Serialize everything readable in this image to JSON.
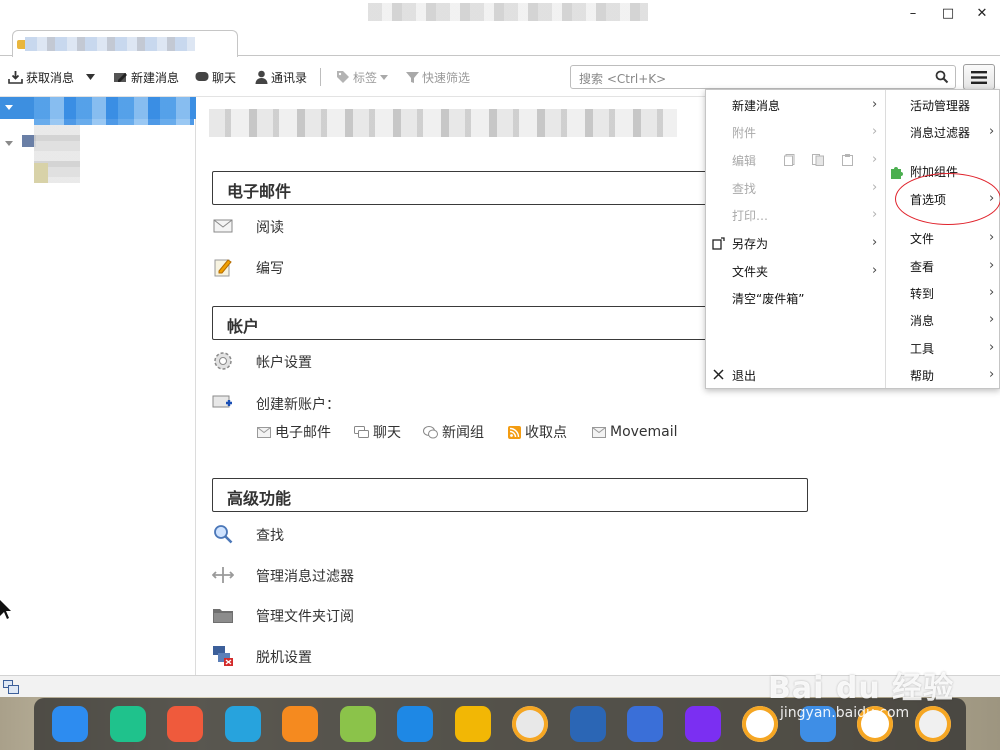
{
  "window": {
    "minimize_glyph": "–",
    "maximize_glyph": "□",
    "close_glyph": "✕"
  },
  "toolbar": {
    "get_messages": "获取消息",
    "new_message": "新建消息",
    "chat": "聊天",
    "address_book": "通讯录",
    "tag": "标签",
    "quick_filter": "快速筛选",
    "search_placeholder": "搜索 <Ctrl+K>"
  },
  "main": {
    "sections": [
      {
        "title": "电子邮件",
        "items": [
          {
            "label": "阅读",
            "icon": "read-mail-icon"
          },
          {
            "label": "编写",
            "icon": "compose-icon"
          }
        ]
      },
      {
        "title": "帐户",
        "items": [
          {
            "label": "帐户设置",
            "icon": "gear-icon"
          },
          {
            "label": "创建新账户：",
            "icon": "new-account-icon"
          }
        ]
      },
      {
        "title": "高级功能",
        "items": [
          {
            "label": "查找",
            "icon": "search-icon"
          },
          {
            "label": "管理消息过滤器",
            "icon": "filter-icon"
          },
          {
            "label": "管理文件夹订阅",
            "icon": "folder-icon"
          },
          {
            "label": "脱机设置",
            "icon": "offline-icon"
          }
        ]
      }
    ],
    "new_account_types": [
      "电子邮件",
      "聊天",
      "新闻组",
      "收取点",
      "Movemail"
    ]
  },
  "menu": {
    "left": [
      {
        "label": "新建消息",
        "enabled": true,
        "submenu": true
      },
      {
        "label": "附件",
        "enabled": false,
        "submenu": true
      },
      {
        "label": "编辑",
        "enabled": false,
        "submenu": true
      },
      {
        "label": "查找",
        "enabled": false,
        "submenu": true
      },
      {
        "label": "打印…",
        "enabled": false,
        "submenu": true
      },
      {
        "label": "另存为",
        "enabled": true,
        "submenu": true
      },
      {
        "label": "文件夹",
        "enabled": true,
        "submenu": true
      },
      {
        "label": "清空“废件箱”",
        "enabled": true,
        "submenu": false
      },
      {
        "label": "退出",
        "enabled": true,
        "submenu": false
      }
    ],
    "right": [
      {
        "label": "活动管理器",
        "submenu": false
      },
      {
        "label": "消息过滤器",
        "submenu": true
      },
      {
        "label": "附加组件",
        "submenu": false
      },
      {
        "label": "首选项",
        "submenu": true
      },
      {
        "label": "文件",
        "submenu": true
      },
      {
        "label": "查看",
        "submenu": true
      },
      {
        "label": "转到",
        "submenu": true
      },
      {
        "label": "消息",
        "submenu": true
      },
      {
        "label": "工具",
        "submenu": true
      },
      {
        "label": "帮助",
        "submenu": true
      }
    ],
    "chevron": "›"
  },
  "dock": {
    "apps": [
      {
        "name": "launcher-icon",
        "color": "#2d8cf0"
      },
      {
        "name": "files-icon",
        "color": "#1fc28c"
      },
      {
        "name": "slides-icon",
        "color": "#ef5a3c"
      },
      {
        "name": "archive-icon",
        "color": "#27a3dd"
      },
      {
        "name": "store-icon",
        "color": "#f58a1f"
      },
      {
        "name": "music-icon",
        "color": "#8bc34a"
      },
      {
        "name": "video-icon",
        "color": "#1e88e5"
      },
      {
        "name": "chrome-icon",
        "color": "#f2b705"
      },
      {
        "name": "settings-icon",
        "color": "#e8e8e8"
      },
      {
        "name": "thunderbird-icon",
        "color": "#2b66b5"
      },
      {
        "name": "keyboard-icon",
        "color": "#3a6fd8"
      },
      {
        "name": "power-icon",
        "color": "#7b2ff2"
      },
      {
        "name": "update-icon",
        "color": "#ffffff"
      },
      {
        "name": "screenshot-icon",
        "color": "#3e8ee6"
      },
      {
        "name": "clock-icon",
        "color": "#ffffff"
      },
      {
        "name": "trash-icon",
        "color": "#f0f0f0"
      }
    ]
  },
  "watermark": {
    "brand": "Bai du 经验",
    "url": "jingyan.baidu.com"
  },
  "accent_color": "#3d8fe0",
  "highlight_color": "#e0232c"
}
